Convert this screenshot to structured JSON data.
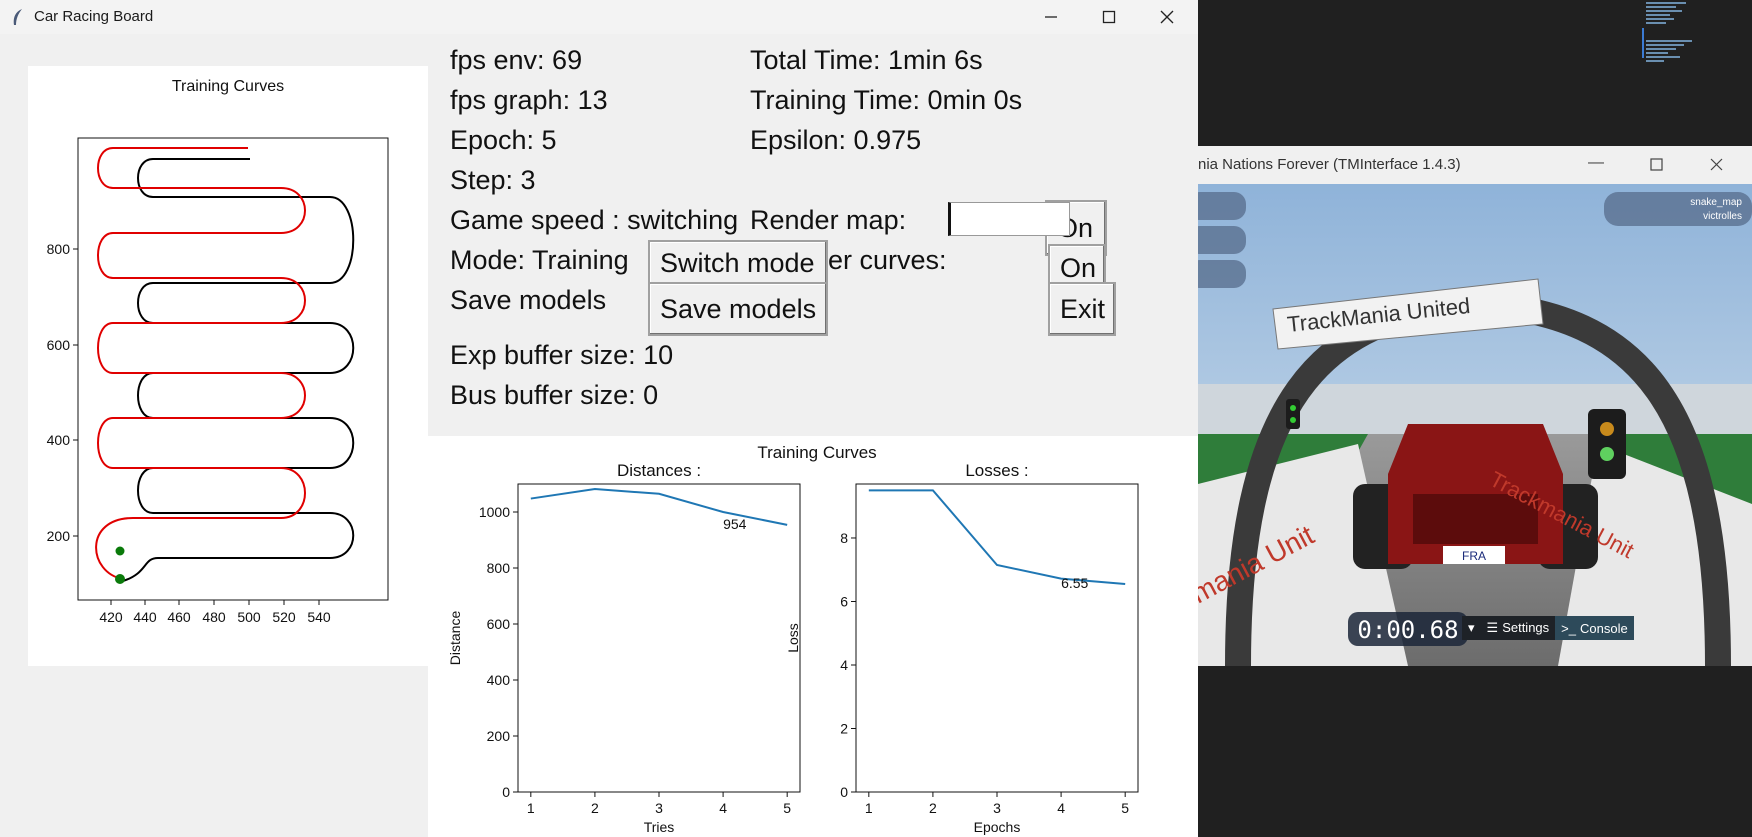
{
  "main_window": {
    "title": "Car Racing Board",
    "controls": [
      "minimize",
      "maximize",
      "close"
    ]
  },
  "track_plot": {
    "title": "Training Curves",
    "x_ticks": [
      "420",
      "440",
      "460",
      "480",
      "500",
      "520",
      "540"
    ],
    "y_ticks": [
      "200",
      "400",
      "600",
      "800"
    ]
  },
  "stats": {
    "fps_env": "fps env: 69",
    "fps_graph": "fps graph: 13",
    "epoch": "Epoch: 5",
    "step": "Step: 3",
    "game_speed": "Game speed : switching",
    "mode": "Mode: Training",
    "save_models_label": "Save models",
    "exp_buffer": "Exp buffer size: 10",
    "bus_buffer": "Bus buffer size: 0",
    "total_time": "Total Time: 1min 6s",
    "training_time": "Training Time: 0min 0s",
    "epsilon": "Epsilon: 0.975",
    "render_map": "Render map:",
    "render_curves_partial": "er curves:"
  },
  "buttons": {
    "switch_mode": "Switch mode",
    "save_models": "Save models",
    "render_map_on": "On",
    "render_curves_on": "On",
    "exit": "Exit"
  },
  "curves_title": "Training Curves",
  "chart_data": [
    {
      "type": "line",
      "title": "Distances :",
      "xlabel": "Tries",
      "ylabel": "Distance",
      "x": [
        1,
        2,
        3,
        4,
        5
      ],
      "values": [
        1048,
        1082,
        1065,
        1000,
        954
      ],
      "xlim": [
        0.8,
        5.2
      ],
      "ylim": [
        0,
        1100
      ],
      "y_ticks": [
        0,
        200,
        400,
        600,
        800,
        1000
      ],
      "annotation": "954",
      "color": "#1f77b4"
    },
    {
      "type": "line",
      "title": "Losses :",
      "xlabel": "Epochs",
      "ylabel": "Loss",
      "x": [
        1,
        2,
        3,
        4,
        5
      ],
      "values": [
        9.5,
        9.5,
        7.15,
        6.72,
        6.55
      ],
      "xlim": [
        0.8,
        5.2
      ],
      "ylim": [
        0,
        9.7
      ],
      "y_ticks": [
        0,
        2,
        4,
        6,
        8
      ],
      "annotation": "6.55",
      "color": "#1f77b4"
    }
  ],
  "game_window": {
    "title": "nia Nations Forever (TMInterface 1.4.3)",
    "banner": "TrackMania United",
    "map_name": "snake_map",
    "author": "victrolles",
    "timer": "0:00.68",
    "plate": "FRA",
    "settings_label": "Settings",
    "console_label": "Console",
    "side_text_left": "mania Unit",
    "side_text_right": "Trackmania Unit"
  }
}
